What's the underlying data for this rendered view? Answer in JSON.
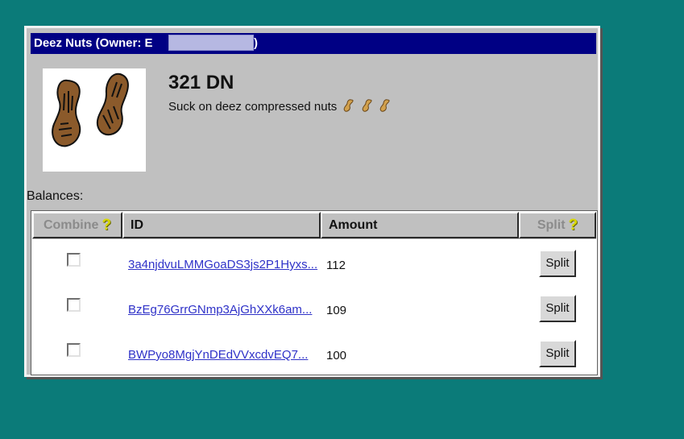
{
  "window": {
    "title_prefix": "Deez Nuts (Owner: E",
    "title_suffix": ")"
  },
  "token": {
    "title": "321 DN",
    "description": "Suck on deez compressed nuts"
  },
  "balances": {
    "label": "Balances:",
    "headers": {
      "combine": "Combine",
      "id": "ID",
      "amount": "Amount",
      "split": "Split"
    },
    "rows": [
      {
        "id": "3a4njdvuLMMGoaDS3js2P1Hyxs...",
        "amount": "112",
        "split": "Split"
      },
      {
        "id": "BzEg76GrrGNmp3AjGhXXk6am...",
        "amount": "109",
        "split": "Split"
      },
      {
        "id": "BWPyo8MgjYnDEdVVxcdvEQ7...",
        "amount": "100",
        "split": "Split"
      }
    ]
  },
  "colors": {
    "desktop": "#0b7b79",
    "titlebar": "#000084",
    "window": "#c0c0c0",
    "link": "#2f32c8",
    "help": "#d8d800",
    "peanut": "#8b5a2b"
  },
  "icons": {
    "logo": "peanut-logo",
    "description": "peanut-emoji",
    "help": "question-mark-icon",
    "checkbox": "checkbox"
  }
}
